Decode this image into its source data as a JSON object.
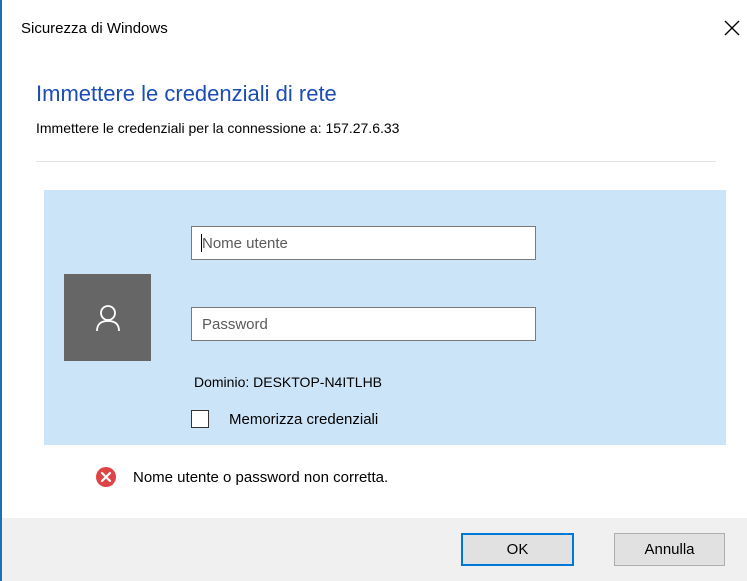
{
  "window": {
    "title": "Sicurezza di Windows"
  },
  "heading": "Immettere le credenziali di rete",
  "subtitle": "Immettere le credenziali per la connessione a: 157.27.6.33",
  "form": {
    "username": {
      "placeholder": "Nome utente",
      "value": ""
    },
    "password": {
      "placeholder": "Password",
      "value": ""
    },
    "domain": "Dominio: DESKTOP-N4ITLHB",
    "remember": {
      "label": "Memorizza credenziali",
      "checked": false
    }
  },
  "error": {
    "message": "Nome utente o password non corretta."
  },
  "buttons": {
    "ok": "OK",
    "cancel": "Annulla"
  },
  "icons": {
    "close": "close-icon",
    "avatar": "user-icon",
    "error": "error-icon"
  },
  "colors": {
    "heading": "#1c4db5",
    "panel": "#cce4f7",
    "avatar_bg": "#666666",
    "error": "#e04343",
    "accent": "#0078d7",
    "footer": "#f0f0f0"
  }
}
